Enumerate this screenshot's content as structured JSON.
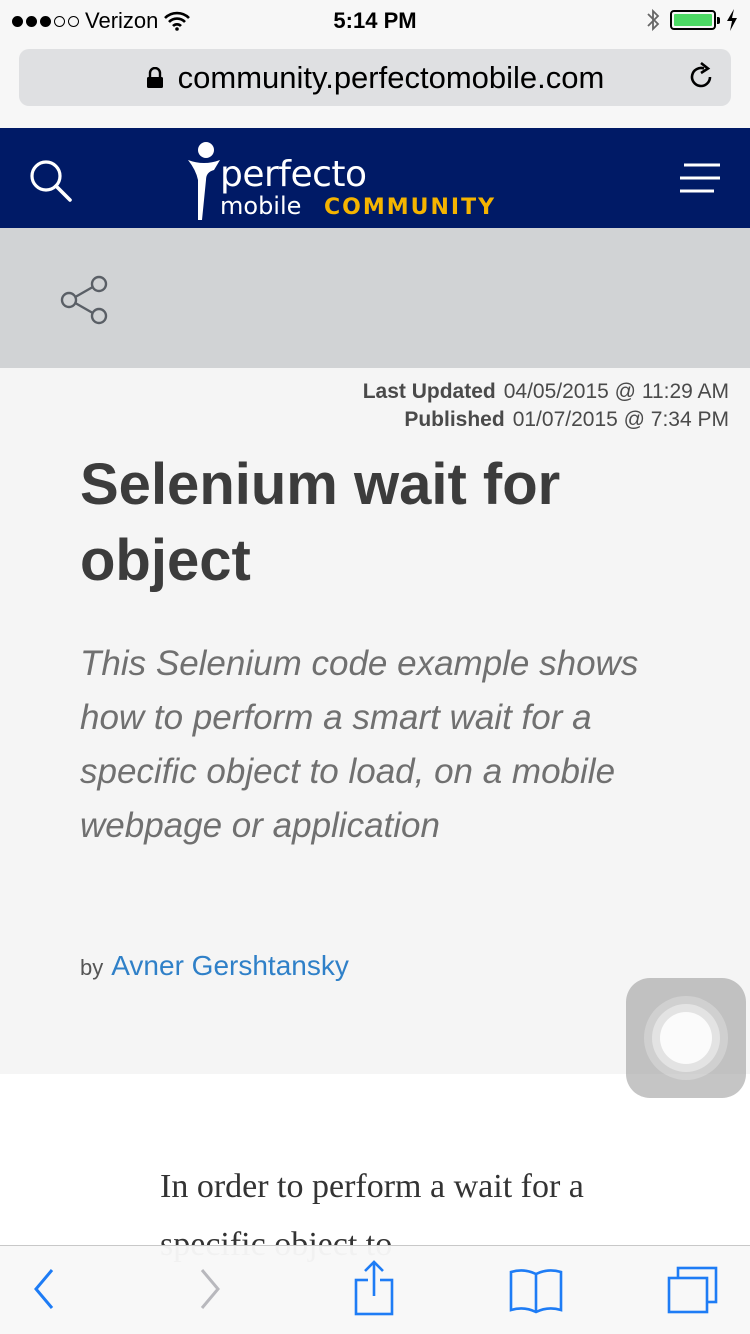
{
  "status_bar": {
    "carrier": "Verizon",
    "time": "5:14 PM",
    "signal_bars_filled": 3,
    "signal_bars_total": 5,
    "battery_color": "#4cd964"
  },
  "browser": {
    "url": "community.perfectomobile.com",
    "icons": [
      "lock-icon",
      "reload-icon"
    ]
  },
  "site_header": {
    "logo_line1": "perfecto",
    "logo_line2": "mobile",
    "logo_line3": "COMMUNITY",
    "background": "#001a66",
    "accent": "#f5b400",
    "icons": [
      "search-icon",
      "hamburger-menu-icon"
    ]
  },
  "share": {
    "icon": "share-icon"
  },
  "article": {
    "last_updated_label": "Last Updated",
    "last_updated_value": "04/05/2015 @ 11:29 AM",
    "published_label": "Published",
    "published_value": "01/07/2015 @ 7:34 PM",
    "title": "Selenium wait for object",
    "summary": "This Selenium code example shows how to perform a smart wait for a specific object to load, on a mobile webpage or application",
    "by_label": "by",
    "author": "Avner Gershtansky",
    "author_color": "#2f80c8",
    "body_start": "In order to perform a wait for a specific object to"
  },
  "toolbar": {
    "icons": [
      "back-icon",
      "forward-icon",
      "share-upload-icon",
      "bookmarks-icon",
      "tabs-icon"
    ],
    "tint": "#1e7cf5"
  }
}
